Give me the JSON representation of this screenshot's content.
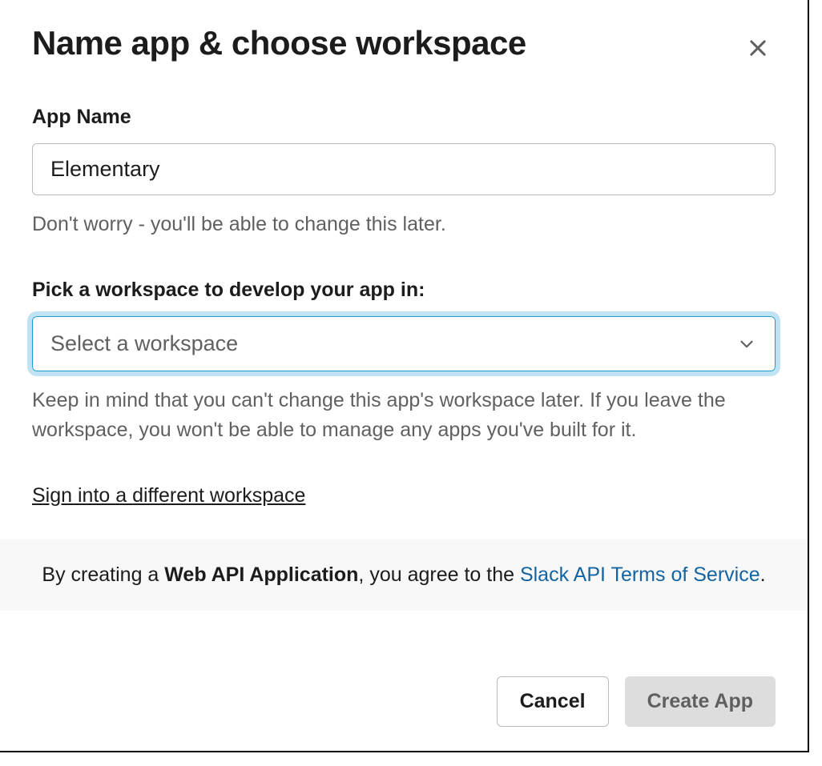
{
  "modal": {
    "title": "Name app & choose workspace"
  },
  "appName": {
    "label": "App Name",
    "value": "Elementary",
    "help": "Don't worry - you'll be able to change this later."
  },
  "workspace": {
    "label": "Pick a workspace to develop your app in:",
    "placeholder": "Select a workspace",
    "help": "Keep in mind that you can't change this app's workspace later. If you leave the workspace, you won't be able to manage any apps you've built for it.",
    "signInLink": "Sign into a different workspace"
  },
  "terms": {
    "prefix": "By creating a ",
    "bold": "Web API Application",
    "middle": ", you agree to the ",
    "linkText": "Slack API Terms of Service",
    "suffix": "."
  },
  "buttons": {
    "cancel": "Cancel",
    "create": "Create App"
  }
}
